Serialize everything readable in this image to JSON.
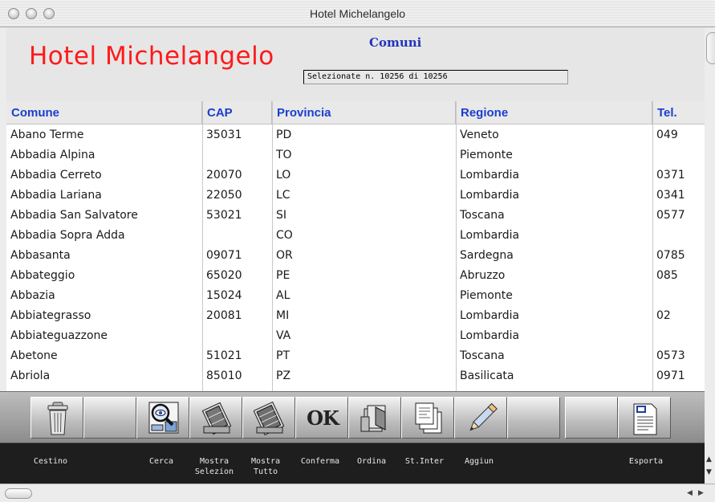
{
  "window": {
    "title": "Hotel Michelangelo"
  },
  "header": {
    "app_title": "Hotel Michelangelo",
    "section_title": "Comuni",
    "selection_count": "Selezionate n. 10256 di 10256"
  },
  "table": {
    "columns": [
      "Comune",
      "CAP",
      "Provincia",
      "Regione",
      "Tel."
    ],
    "rows": [
      {
        "comune": "Abano Terme",
        "cap": "35031",
        "provincia": "PD",
        "regione": "Veneto",
        "tel": "049"
      },
      {
        "comune": "Abbadia Alpina",
        "cap": "",
        "provincia": "TO",
        "regione": "Piemonte",
        "tel": ""
      },
      {
        "comune": "Abbadia Cerreto",
        "cap": "20070",
        "provincia": "LO",
        "regione": "Lombardia",
        "tel": "0371"
      },
      {
        "comune": "Abbadia Lariana",
        "cap": "22050",
        "provincia": "LC",
        "regione": "Lombardia",
        "tel": "0341"
      },
      {
        "comune": "Abbadia San Salvatore",
        "cap": "53021",
        "provincia": "SI",
        "regione": "Toscana",
        "tel": "0577"
      },
      {
        "comune": "Abbadia Sopra Adda",
        "cap": "",
        "provincia": "CO",
        "regione": "Lombardia",
        "tel": ""
      },
      {
        "comune": "Abbasanta",
        "cap": "09071",
        "provincia": "OR",
        "regione": "Sardegna",
        "tel": "0785"
      },
      {
        "comune": "Abbateggio",
        "cap": "65020",
        "provincia": "PE",
        "regione": "Abruzzo",
        "tel": "085"
      },
      {
        "comune": "Abbazia",
        "cap": "15024",
        "provincia": "AL",
        "regione": "Piemonte",
        "tel": ""
      },
      {
        "comune": "Abbiategrasso",
        "cap": "20081",
        "provincia": "MI",
        "regione": "Lombardia",
        "tel": "02"
      },
      {
        "comune": "Abbiateguazzone",
        "cap": "",
        "provincia": "VA",
        "regione": "Lombardia",
        "tel": ""
      },
      {
        "comune": "Abetone",
        "cap": "51021",
        "provincia": "PT",
        "regione": "Toscana",
        "tel": "0573"
      },
      {
        "comune": "Abriola",
        "cap": "85010",
        "provincia": "PZ",
        "regione": "Basilicata",
        "tel": "0971"
      }
    ]
  },
  "toolbar": {
    "cestino": "Cestino",
    "cerca": "Cerca",
    "mostra_selezion_1": "Mostra",
    "mostra_selezion_2": "Selezion",
    "mostra_tutto_1": "Mostra",
    "mostra_tutto_2": "Tutto",
    "conferma": "Conferma",
    "ordina": "Ordina",
    "st_inter": "St.Inter",
    "aggiun": "Aggiun",
    "esporta": "Esporta",
    "ok_glyph": "OK"
  },
  "icons": {
    "trash": "trash-icon",
    "search": "search-icon",
    "show_selection": "film-reel-icon",
    "show_all": "film-reel-icon",
    "confirm": "ok-icon",
    "sort": "sort-cards-icon",
    "print": "print-pages-icon",
    "add": "pencil-icon",
    "export": "document-export-icon"
  },
  "colors": {
    "app_title": "#ff1a1a",
    "column_header": "#1a3fcc",
    "section_title": "#2233bb",
    "label_bar": "#1e1e1e"
  }
}
